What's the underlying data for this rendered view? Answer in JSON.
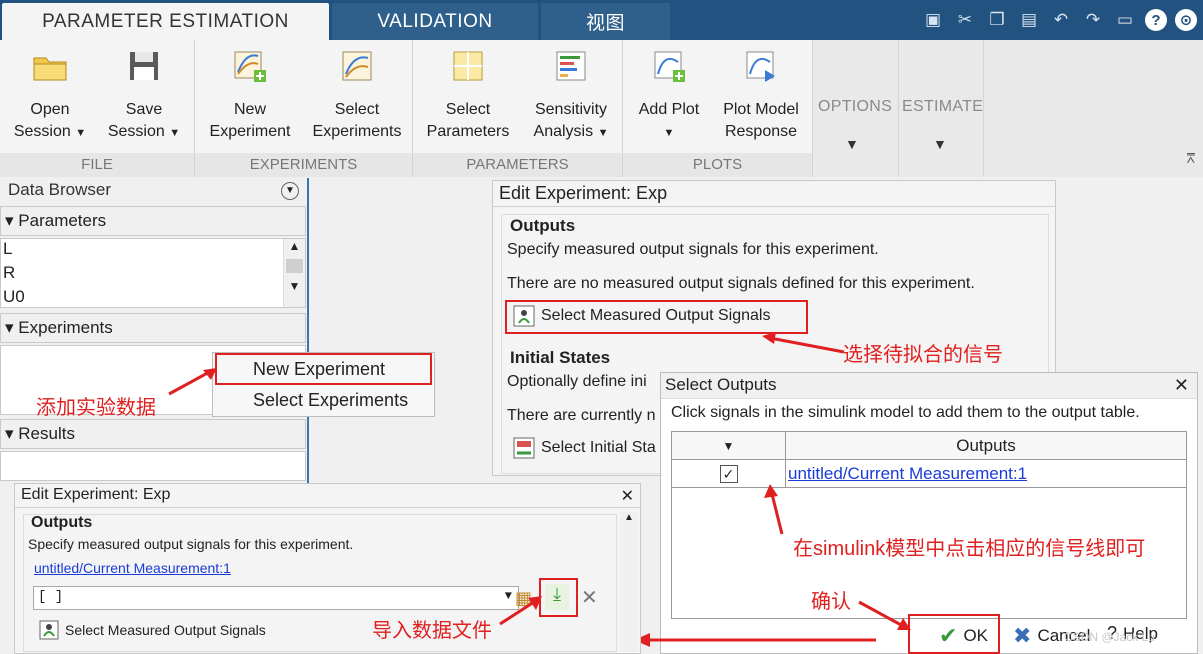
{
  "tabs": [
    "PARAMETER ESTIMATION",
    "VALIDATION",
    "视图"
  ],
  "ribbon": {
    "file": {
      "label": "FILE",
      "open_line1": "Open",
      "open_line2": "Session",
      "save_line1": "Save",
      "save_line2": "Session"
    },
    "experiments": {
      "label": "EXPERIMENTS",
      "new_line1": "New",
      "new_line2": "Experiment",
      "select_line1": "Select",
      "select_line2": "Experiments"
    },
    "parameters": {
      "label": "PARAMETERS",
      "select_line1": "Select",
      "select_line2": "Parameters",
      "sens_line1": "Sensitivity",
      "sens_line2": "Analysis"
    },
    "plots": {
      "label": "PLOTS",
      "add_line1": "Add Plot",
      "model_line1": "Plot Model",
      "model_line2": "Response"
    },
    "options": "OPTIONS",
    "estimate": "ESTIMATE"
  },
  "data_browser": {
    "title": "Data Browser",
    "parameters_head": "Parameters",
    "parameters": [
      "L",
      "R",
      "U0"
    ],
    "experiments_head": "Experiments",
    "results_head": "Results",
    "context_menu": [
      "New Experiment",
      "Select Experiments"
    ]
  },
  "edit_top": {
    "title": "Edit Experiment: Exp",
    "outputs_head": "Outputs",
    "outputs_desc": "Specify measured output signals for this experiment.",
    "no_signals": "There are no measured output signals defined for this experiment.",
    "select_btn": "Select Measured Output Signals",
    "initial_head": "Initial States",
    "initial_desc": "Optionally define ini",
    "currently": "There are currently n",
    "select_initial_btn": "Select Initial Sta"
  },
  "select_outputs": {
    "title": "Select Outputs",
    "instruction": "Click signals in the simulink model to add them to the output table.",
    "col_outputs": "Outputs",
    "row_signal": "untitled/Current Measurement:1",
    "ok": "OK",
    "cancel": "Cancel",
    "help": "Help"
  },
  "edit_bottom": {
    "title": "Edit Experiment: Exp",
    "outputs_head": "Outputs",
    "outputs_desc": "Specify measured output signals for this experiment.",
    "signal_link": "untitled/Current Measurement:1",
    "combo_value": "[ ]",
    "select_btn": "Select Measured Output Signals"
  },
  "annotations": {
    "add_data": "添加实验数据",
    "choose_signal": "选择待拟合的信号",
    "click_signal": "在simulink模型中点击相应的信号线即可",
    "confirm": "确认",
    "import_file": "导入数据文件"
  },
  "watermark": "CSDN @Jack Lu",
  "colors": {
    "accent_red": "#e02020",
    "tabbar_blue": "#22527f",
    "link_blue": "#1a3bd8"
  }
}
